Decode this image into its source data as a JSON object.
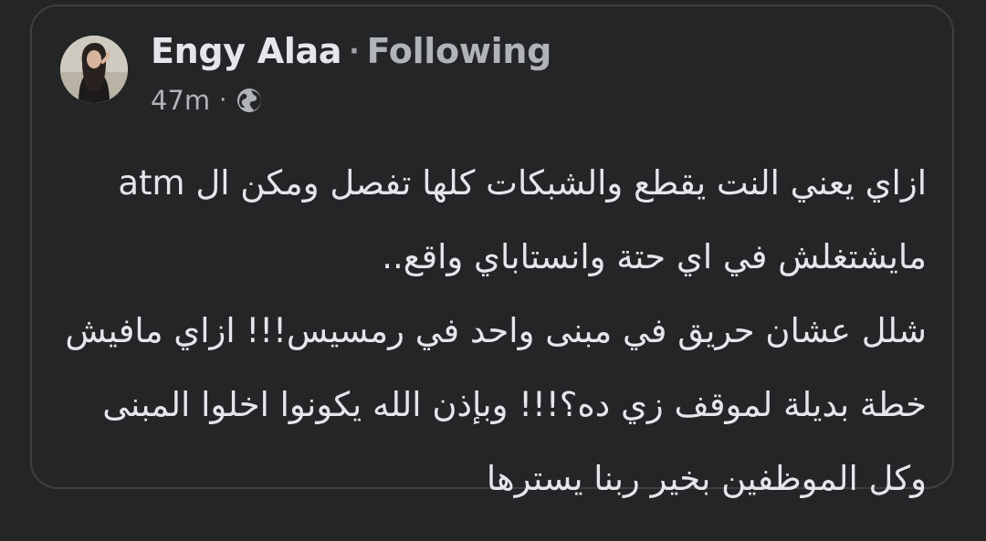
{
  "post": {
    "author_name": "Engy Alaa",
    "separator": "·",
    "follow_status": "Following",
    "time": "47m",
    "meta_separator": "·",
    "audience_icon": "globe-icon",
    "text_lines": [
      "ازاي يعني النت يقطع والشبكات كلها تفصل ومكن ال atm",
      "مايشتغلش في اي حتة وانستاباي واقع..",
      "شلل عشان حريق في مبنى واحد في رمسيس!!! ازاي مافيش",
      "خطة بديلة لموقف زي ده؟!!! وبإذن الله يكونوا اخلوا المبنى",
      "وكل الموظفين بخير ربنا يسترها"
    ]
  },
  "colors": {
    "background": "#242526",
    "card_border": "#3e4042",
    "primary_text": "#e4e6eb",
    "secondary_text": "#b0b3b8"
  }
}
